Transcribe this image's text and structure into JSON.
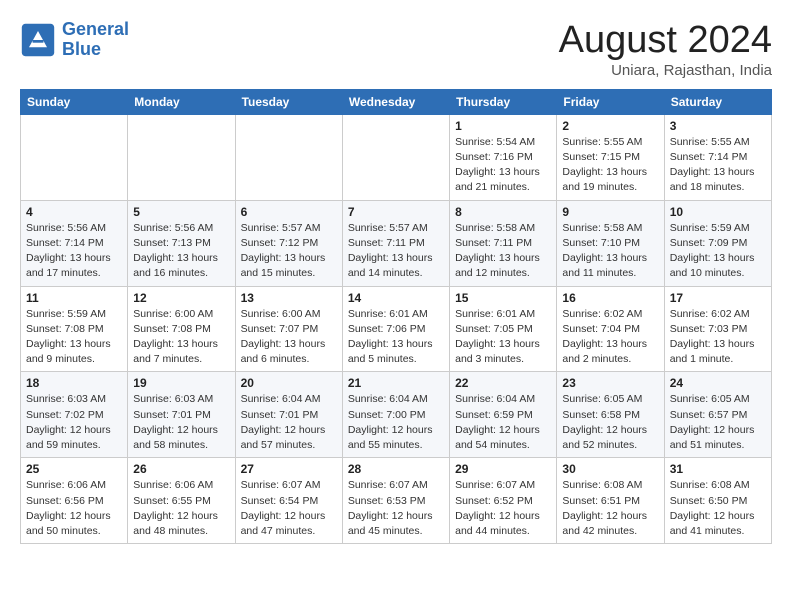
{
  "header": {
    "logo_line1": "General",
    "logo_line2": "Blue",
    "month_title": "August 2024",
    "location": "Uniara, Rajasthan, India"
  },
  "weekdays": [
    "Sunday",
    "Monday",
    "Tuesday",
    "Wednesday",
    "Thursday",
    "Friday",
    "Saturday"
  ],
  "weeks": [
    [
      {
        "day": "",
        "info": ""
      },
      {
        "day": "",
        "info": ""
      },
      {
        "day": "",
        "info": ""
      },
      {
        "day": "",
        "info": ""
      },
      {
        "day": "1",
        "info": "Sunrise: 5:54 AM\nSunset: 7:16 PM\nDaylight: 13 hours\nand 21 minutes."
      },
      {
        "day": "2",
        "info": "Sunrise: 5:55 AM\nSunset: 7:15 PM\nDaylight: 13 hours\nand 19 minutes."
      },
      {
        "day": "3",
        "info": "Sunrise: 5:55 AM\nSunset: 7:14 PM\nDaylight: 13 hours\nand 18 minutes."
      }
    ],
    [
      {
        "day": "4",
        "info": "Sunrise: 5:56 AM\nSunset: 7:14 PM\nDaylight: 13 hours\nand 17 minutes."
      },
      {
        "day": "5",
        "info": "Sunrise: 5:56 AM\nSunset: 7:13 PM\nDaylight: 13 hours\nand 16 minutes."
      },
      {
        "day": "6",
        "info": "Sunrise: 5:57 AM\nSunset: 7:12 PM\nDaylight: 13 hours\nand 15 minutes."
      },
      {
        "day": "7",
        "info": "Sunrise: 5:57 AM\nSunset: 7:11 PM\nDaylight: 13 hours\nand 14 minutes."
      },
      {
        "day": "8",
        "info": "Sunrise: 5:58 AM\nSunset: 7:11 PM\nDaylight: 13 hours\nand 12 minutes."
      },
      {
        "day": "9",
        "info": "Sunrise: 5:58 AM\nSunset: 7:10 PM\nDaylight: 13 hours\nand 11 minutes."
      },
      {
        "day": "10",
        "info": "Sunrise: 5:59 AM\nSunset: 7:09 PM\nDaylight: 13 hours\nand 10 minutes."
      }
    ],
    [
      {
        "day": "11",
        "info": "Sunrise: 5:59 AM\nSunset: 7:08 PM\nDaylight: 13 hours\nand 9 minutes."
      },
      {
        "day": "12",
        "info": "Sunrise: 6:00 AM\nSunset: 7:08 PM\nDaylight: 13 hours\nand 7 minutes."
      },
      {
        "day": "13",
        "info": "Sunrise: 6:00 AM\nSunset: 7:07 PM\nDaylight: 13 hours\nand 6 minutes."
      },
      {
        "day": "14",
        "info": "Sunrise: 6:01 AM\nSunset: 7:06 PM\nDaylight: 13 hours\nand 5 minutes."
      },
      {
        "day": "15",
        "info": "Sunrise: 6:01 AM\nSunset: 7:05 PM\nDaylight: 13 hours\nand 3 minutes."
      },
      {
        "day": "16",
        "info": "Sunrise: 6:02 AM\nSunset: 7:04 PM\nDaylight: 13 hours\nand 2 minutes."
      },
      {
        "day": "17",
        "info": "Sunrise: 6:02 AM\nSunset: 7:03 PM\nDaylight: 13 hours\nand 1 minute."
      }
    ],
    [
      {
        "day": "18",
        "info": "Sunrise: 6:03 AM\nSunset: 7:02 PM\nDaylight: 12 hours\nand 59 minutes."
      },
      {
        "day": "19",
        "info": "Sunrise: 6:03 AM\nSunset: 7:01 PM\nDaylight: 12 hours\nand 58 minutes."
      },
      {
        "day": "20",
        "info": "Sunrise: 6:04 AM\nSunset: 7:01 PM\nDaylight: 12 hours\nand 57 minutes."
      },
      {
        "day": "21",
        "info": "Sunrise: 6:04 AM\nSunset: 7:00 PM\nDaylight: 12 hours\nand 55 minutes."
      },
      {
        "day": "22",
        "info": "Sunrise: 6:04 AM\nSunset: 6:59 PM\nDaylight: 12 hours\nand 54 minutes."
      },
      {
        "day": "23",
        "info": "Sunrise: 6:05 AM\nSunset: 6:58 PM\nDaylight: 12 hours\nand 52 minutes."
      },
      {
        "day": "24",
        "info": "Sunrise: 6:05 AM\nSunset: 6:57 PM\nDaylight: 12 hours\nand 51 minutes."
      }
    ],
    [
      {
        "day": "25",
        "info": "Sunrise: 6:06 AM\nSunset: 6:56 PM\nDaylight: 12 hours\nand 50 minutes."
      },
      {
        "day": "26",
        "info": "Sunrise: 6:06 AM\nSunset: 6:55 PM\nDaylight: 12 hours\nand 48 minutes."
      },
      {
        "day": "27",
        "info": "Sunrise: 6:07 AM\nSunset: 6:54 PM\nDaylight: 12 hours\nand 47 minutes."
      },
      {
        "day": "28",
        "info": "Sunrise: 6:07 AM\nSunset: 6:53 PM\nDaylight: 12 hours\nand 45 minutes."
      },
      {
        "day": "29",
        "info": "Sunrise: 6:07 AM\nSunset: 6:52 PM\nDaylight: 12 hours\nand 44 minutes."
      },
      {
        "day": "30",
        "info": "Sunrise: 6:08 AM\nSunset: 6:51 PM\nDaylight: 12 hours\nand 42 minutes."
      },
      {
        "day": "31",
        "info": "Sunrise: 6:08 AM\nSunset: 6:50 PM\nDaylight: 12 hours\nand 41 minutes."
      }
    ]
  ]
}
